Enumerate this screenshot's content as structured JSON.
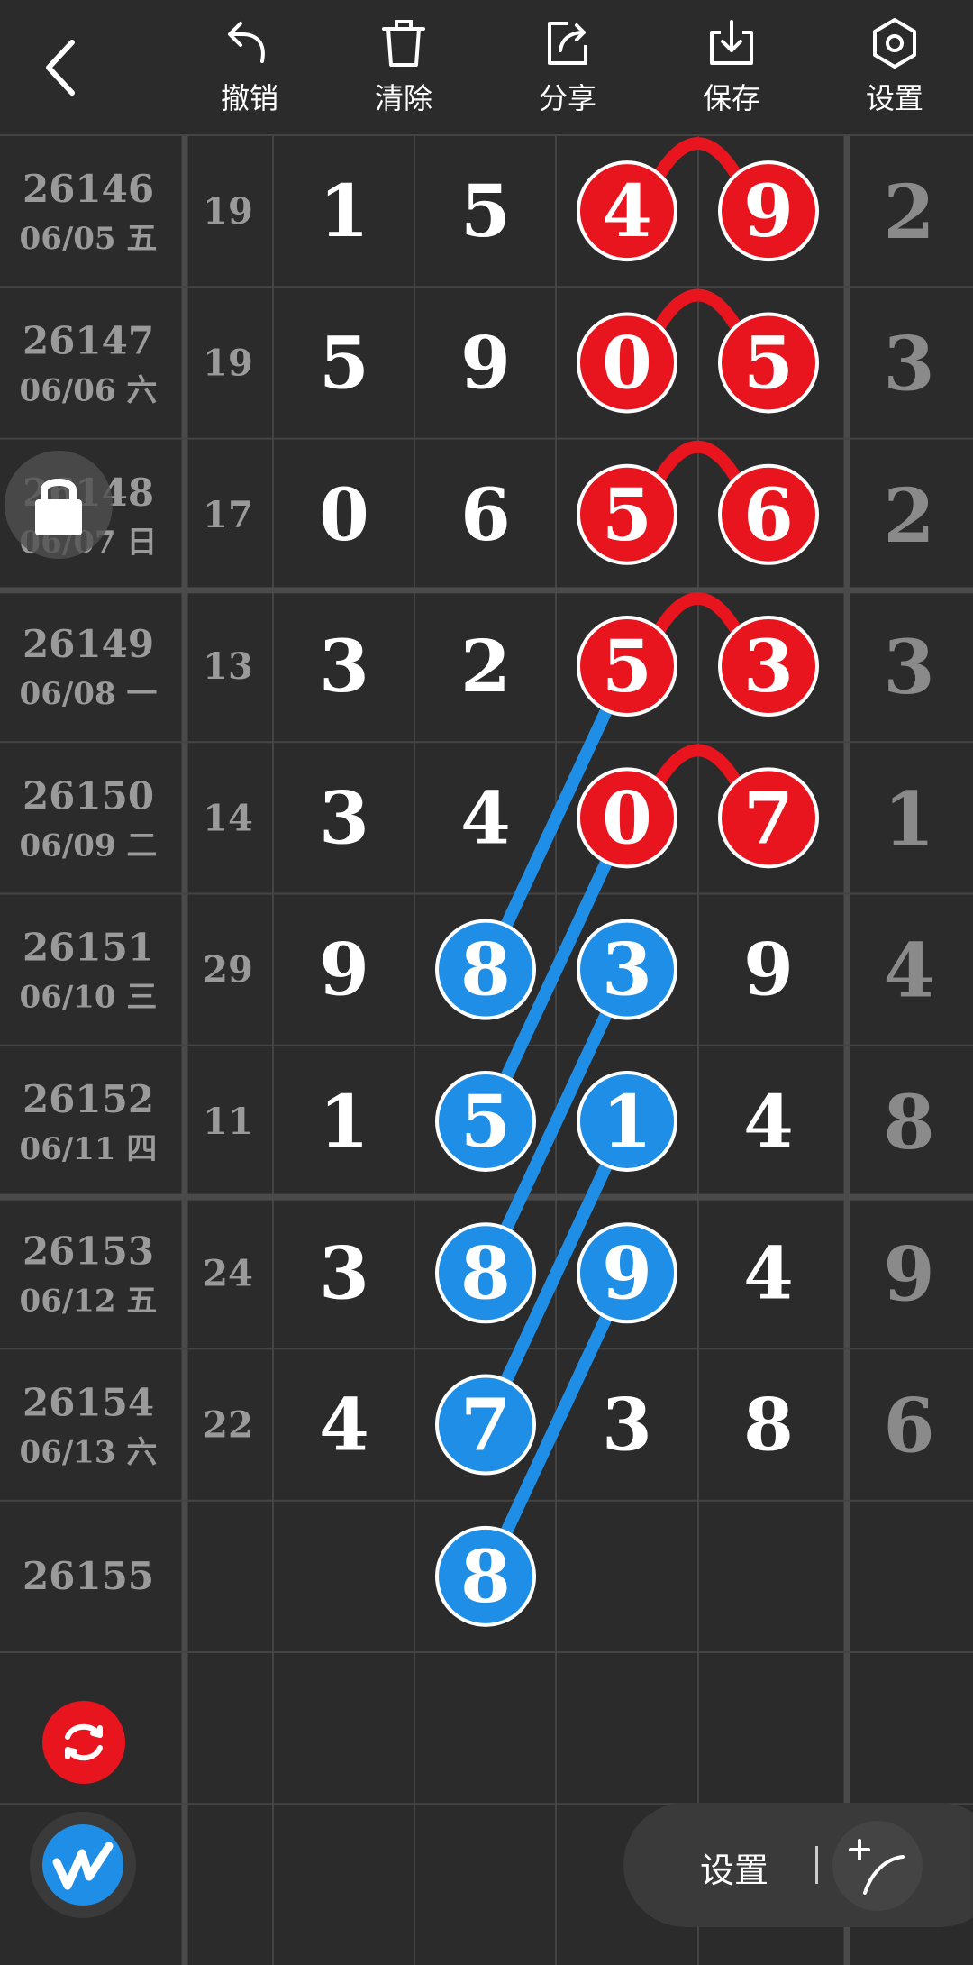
{
  "toolbar": {
    "back_label": "",
    "undo_label": "撤销",
    "clear_label": "清除",
    "share_label": "分享",
    "save_label": "保存",
    "settings_label": "设置"
  },
  "rows": [
    {
      "issue": "26146",
      "date": "06/05 五",
      "sum": "19",
      "digits": [
        "1",
        "5",
        "4",
        "9"
      ],
      "tail": "2"
    },
    {
      "issue": "26147",
      "date": "06/06 六",
      "sum": "19",
      "digits": [
        "5",
        "9",
        "0",
        "5"
      ],
      "tail": "3"
    },
    {
      "issue": "26148",
      "date": "06/07 日",
      "sum": "17",
      "digits": [
        "0",
        "6",
        "5",
        "6"
      ],
      "tail": "2"
    },
    {
      "issue": "26149",
      "date": "06/08 一",
      "sum": "13",
      "digits": [
        "3",
        "2",
        "5",
        "3"
      ],
      "tail": "3"
    },
    {
      "issue": "26150",
      "date": "06/09 二",
      "sum": "14",
      "digits": [
        "3",
        "4",
        "0",
        "7"
      ],
      "tail": "1"
    },
    {
      "issue": "26151",
      "date": "06/10 三",
      "sum": "29",
      "digits": [
        "9",
        "8",
        "3",
        "9"
      ],
      "tail": "4"
    },
    {
      "issue": "26152",
      "date": "06/11 四",
      "sum": "11",
      "digits": [
        "1",
        "5",
        "1",
        "4"
      ],
      "tail": "8"
    },
    {
      "issue": "26153",
      "date": "06/12 五",
      "sum": "24",
      "digits": [
        "3",
        "8",
        "9",
        "4"
      ],
      "tail": "9"
    },
    {
      "issue": "26154",
      "date": "06/13 六",
      "sum": "22",
      "digits": [
        "4",
        "7",
        "3",
        "8"
      ],
      "tail": "6"
    },
    {
      "issue": "26155",
      "date": "",
      "sum": "",
      "digits": [
        "",
        "8",
        "",
        ""
      ],
      "tail": ""
    }
  ],
  "red_marks": [
    {
      "row": 0,
      "col": 2
    },
    {
      "row": 0,
      "col": 3
    },
    {
      "row": 1,
      "col": 2
    },
    {
      "row": 1,
      "col": 3
    },
    {
      "row": 2,
      "col": 2
    },
    {
      "row": 2,
      "col": 3
    },
    {
      "row": 3,
      "col": 2
    },
    {
      "row": 3,
      "col": 3
    },
    {
      "row": 4,
      "col": 2
    },
    {
      "row": 4,
      "col": 3
    }
  ],
  "red_arcs": [
    {
      "row": 0,
      "from": 2,
      "to": 3
    },
    {
      "row": 1,
      "from": 2,
      "to": 3
    },
    {
      "row": 2,
      "from": 2,
      "to": 3
    },
    {
      "row": 3,
      "from": 2,
      "to": 3
    },
    {
      "row": 4,
      "from": 2,
      "to": 3
    }
  ],
  "blue_marks": [
    {
      "row": 5,
      "col": 1
    },
    {
      "row": 5,
      "col": 2
    },
    {
      "row": 6,
      "col": 1
    },
    {
      "row": 6,
      "col": 2
    },
    {
      "row": 7,
      "col": 1
    },
    {
      "row": 7,
      "col": 2
    },
    {
      "row": 8,
      "col": 1
    },
    {
      "row": 9,
      "col": 1
    }
  ],
  "blue_lines": [
    {
      "from": {
        "row": 3,
        "col": 2
      },
      "to": {
        "row": 5,
        "col": 1
      }
    },
    {
      "from": {
        "row": 4,
        "col": 2
      },
      "to": {
        "row": 6,
        "col": 1
      }
    },
    {
      "from": {
        "row": 5,
        "col": 2
      },
      "to": {
        "row": 7,
        "col": 1
      }
    },
    {
      "from": {
        "row": 6,
        "col": 2
      },
      "to": {
        "row": 8,
        "col": 1
      }
    },
    {
      "from": {
        "row": 7,
        "col": 2
      },
      "to": {
        "row": 9,
        "col": 1
      }
    }
  ],
  "colors": {
    "background": "#2b2b2b",
    "grid": "#444444",
    "grid_thick": "#4a4a4a",
    "issue_text": "#9a9a9a",
    "digit_text": "#ffffff",
    "tail_text": "#8a8a8a",
    "red": "#e8141e",
    "blue": "#1e8ee6",
    "ball_stroke": "#ffffff"
  },
  "bottom": {
    "settings_label": "设置"
  }
}
